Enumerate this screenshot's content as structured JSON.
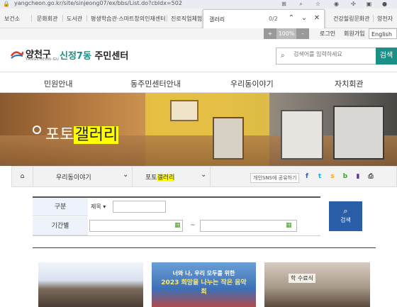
{
  "browser": {
    "url": "yangcheon.go.kr/site/sinjeong07/ex/bbs/List.do?cbIdx=502"
  },
  "topnav": {
    "items": [
      "보건소",
      "문화회관",
      "도서관",
      "평생학습관·스마트창의인재센터",
      "진로직업체험지",
      "건강힐링문화관",
      "양천자"
    ]
  },
  "findbar": {
    "query": "갤러리",
    "count": "0/2"
  },
  "util": {
    "zoom_plus": "+",
    "zoom_level": "100%",
    "zoom_minus": "-",
    "login": "로그인",
    "join": "회원가입",
    "language": "English"
  },
  "header": {
    "logo_name": "양천구",
    "logo_sub": "YANGCHEON-GU",
    "site_title_accent": "신정7동",
    "site_title_rest": "주민센터",
    "search_placeholder": "검색어를 입력하세요",
    "search_button": "검색"
  },
  "menu": [
    "민원안내",
    "동주민센터안내",
    "우리동이야기",
    "자치회관"
  ],
  "banner": {
    "title_pre": "포토",
    "title_hl": "갤러리"
  },
  "location": {
    "level1": "우리동이야기",
    "level2_pre": "포토",
    "level2_hl": "갤러리",
    "share_label": "개인SNS에 공유하기"
  },
  "search_form": {
    "label_category": "구분",
    "select_value": "제목",
    "label_period": "기간별",
    "tilde": "~",
    "submit": "검색"
  },
  "gallery": {
    "thumb2_caption_top": "너와 나, 우리 모두를 위한",
    "thumb2_caption_year": "2023 희망을 나누는 작은 음악회",
    "thumb3_caption": "학 수료식"
  },
  "colors": {
    "brand": "#1c8f86",
    "search_button": "#2a5ea8",
    "highlight": "#ffff00"
  }
}
